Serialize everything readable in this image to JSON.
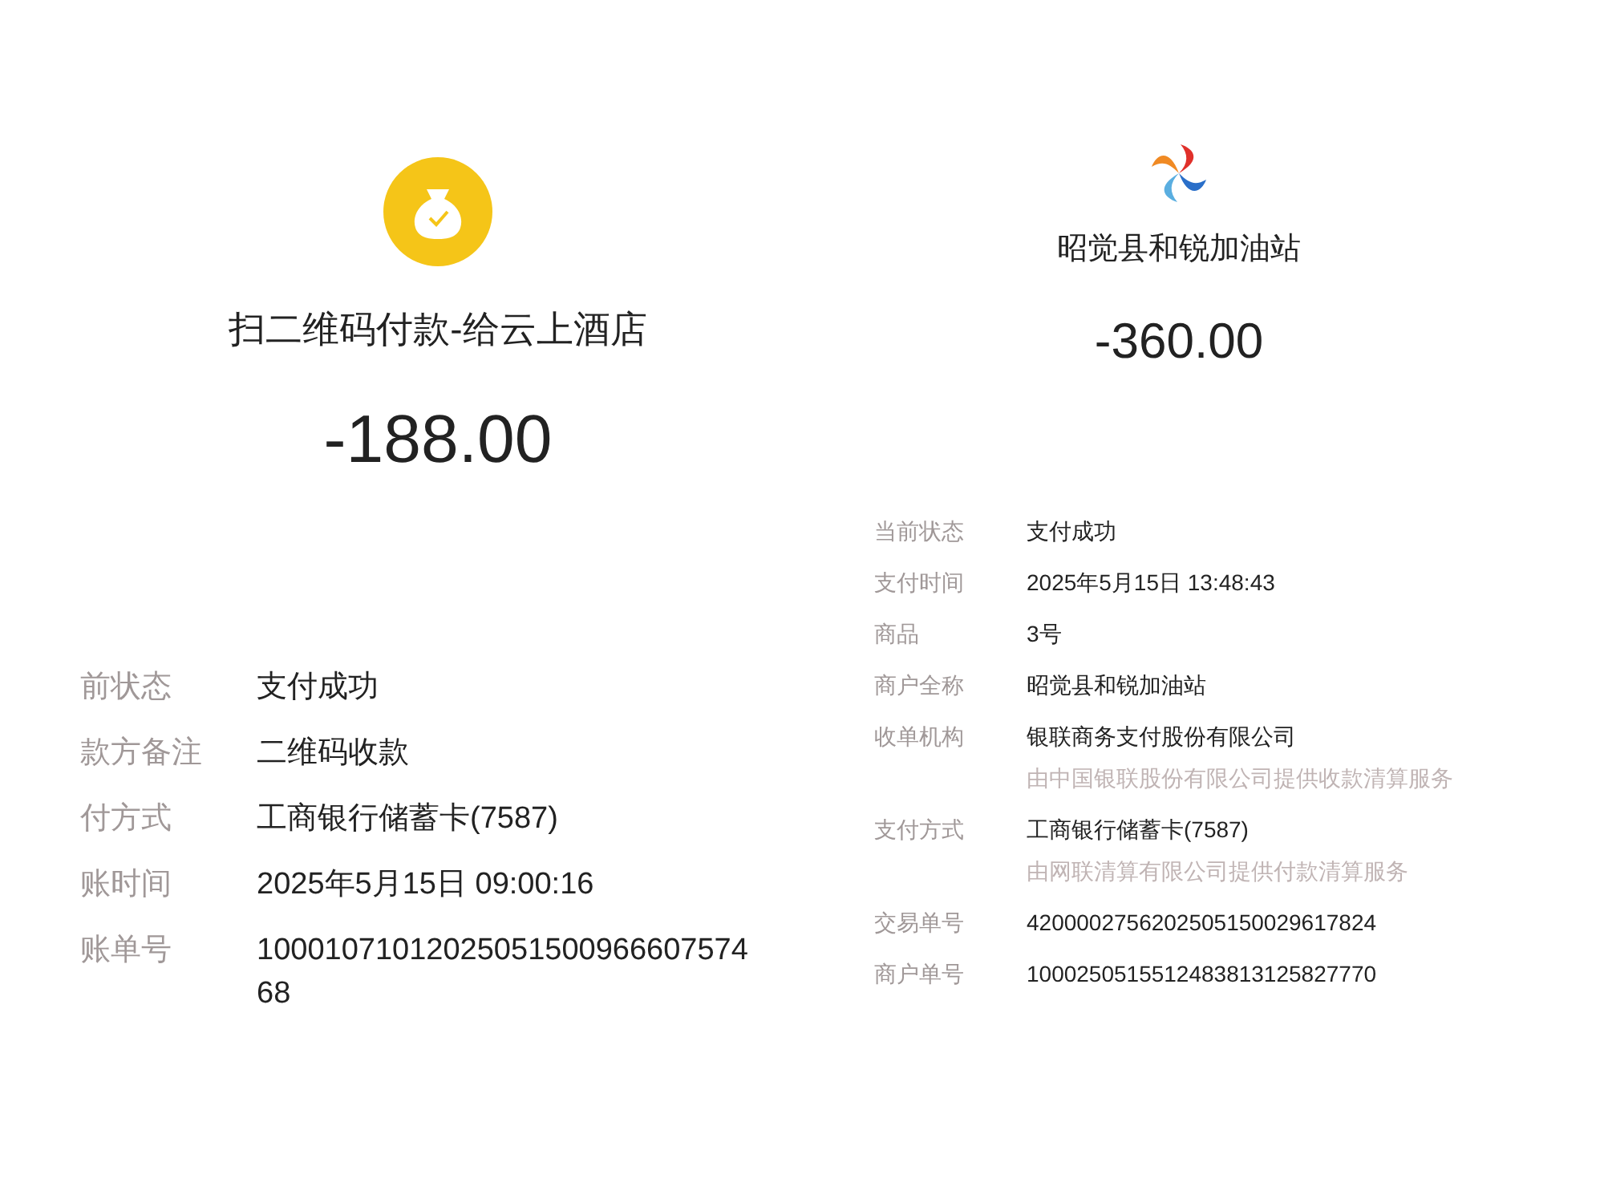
{
  "left_receipt": {
    "title": "扫二维码付款-给云上酒店",
    "amount": "-188.00",
    "details": [
      {
        "label": "前状态",
        "value": [
          "支付成功"
        ]
      },
      {
        "label": "款方备注",
        "value": [
          "二维码收款"
        ]
      },
      {
        "label": "付方式",
        "value": [
          "工商银行储蓄卡(7587)"
        ]
      },
      {
        "label": "账时间",
        "value": [
          "2025年5月15日 09:00:16"
        ]
      },
      {
        "label": "账单号",
        "value": [
          "10001071012025051500966607574",
          "68"
        ]
      }
    ]
  },
  "right_receipt": {
    "title": "昭觉县和锐加油站",
    "amount": "-360.00",
    "details": [
      {
        "label": "当前状态",
        "value": "支付成功"
      },
      {
        "label": "支付时间",
        "value": "2025年5月15日 13:48:43"
      },
      {
        "label": "商品",
        "value": "3号"
      },
      {
        "label": "商户全称",
        "value": "昭觉县和锐加油站"
      },
      {
        "label": "收单机构",
        "value": "银联商务支付股份有限公司",
        "note": "由中国银联股份有限公司提供收款清算服务"
      },
      {
        "label": "支付方式",
        "value": "工商银行储蓄卡(7587)",
        "note": "由网联清算有限公司提供付款清算服务"
      },
      {
        "label": "交易单号",
        "value": "4200002756202505150029617824"
      },
      {
        "label": "商户单号",
        "value": "1000250515512483813125827770"
      }
    ]
  }
}
